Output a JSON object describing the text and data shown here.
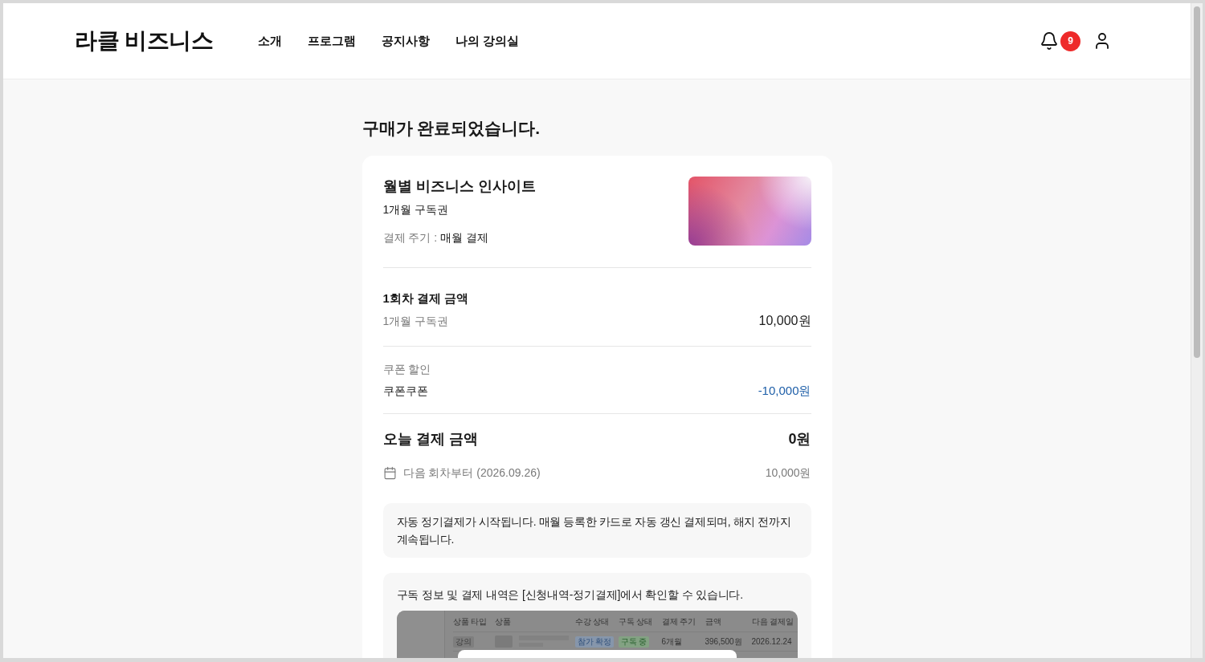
{
  "header": {
    "logo": "라클 비즈니스",
    "nav": [
      {
        "label": "소개"
      },
      {
        "label": "프로그램"
      },
      {
        "label": "공지사항"
      },
      {
        "label": "나의 강의실"
      }
    ],
    "notification_count": "9"
  },
  "page_title": "구매가 완료되었습니다.",
  "product": {
    "name": "월별 비즈니스 인사이트",
    "plan": "1개월 구독권",
    "cycle_label": "결제 주기 :",
    "cycle_value": "매월 결제"
  },
  "first_payment": {
    "title": "1회차 결제 금액",
    "item": "1개월 구독권",
    "amount": "10,000원"
  },
  "coupon": {
    "title": "쿠폰 할인",
    "name": "쿠폰쿠폰",
    "amount": "-10,000원"
  },
  "today_payment": {
    "title": "오늘 결제 금액",
    "amount": "0원",
    "next_label": "다음 회차부터 (2026.09.26)",
    "next_amount": "10,000원"
  },
  "auto_payment_notice": "자동 정기결제가 시작됩니다. 매월 등록한 카드로 자동 갱신 결제되며, 해지 전까지 계속됩니다.",
  "history_notice": {
    "text": "구독 정보 및 결제 내역은 [신청내역-정기결제]에서 확인할 수 있습니다.",
    "screenshot": {
      "columns": [
        "상품 타입",
        "상품",
        "수강 상태",
        "구독 상태",
        "결제 주기",
        "금액",
        "다음 결제일"
      ],
      "rows": [
        {
          "type": "강의",
          "status": "참가 확정",
          "subscription": "구독 중",
          "cycle": "6개월",
          "amount": "396,500원",
          "next_date": "2026.12.24"
        }
      ]
    }
  }
}
